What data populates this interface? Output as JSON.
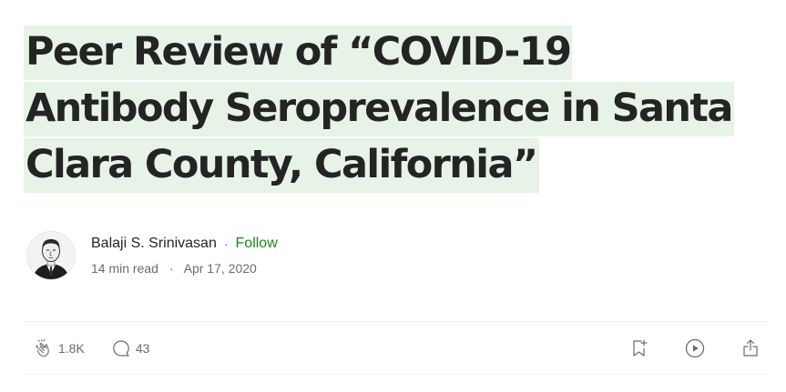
{
  "article": {
    "title": "Peer Review of “COVID-19 Antibody Seroprevalence in Santa Clara County, California”"
  },
  "author": {
    "name": "Balaji S. Srinivasan",
    "separator": "·",
    "follow_label": "Follow",
    "read_time": "14 min read",
    "date": "Apr 17, 2020"
  },
  "actions": {
    "claps_count": "1.8K",
    "comments_count": "43",
    "icons": [
      "clap-icon",
      "comment-icon",
      "bookmark-add-icon",
      "play-icon",
      "share-icon"
    ]
  },
  "colors": {
    "text": "#242424",
    "muted": "#6b6b6b",
    "follow": "#1a8917",
    "highlight": "#e6f3e6"
  }
}
